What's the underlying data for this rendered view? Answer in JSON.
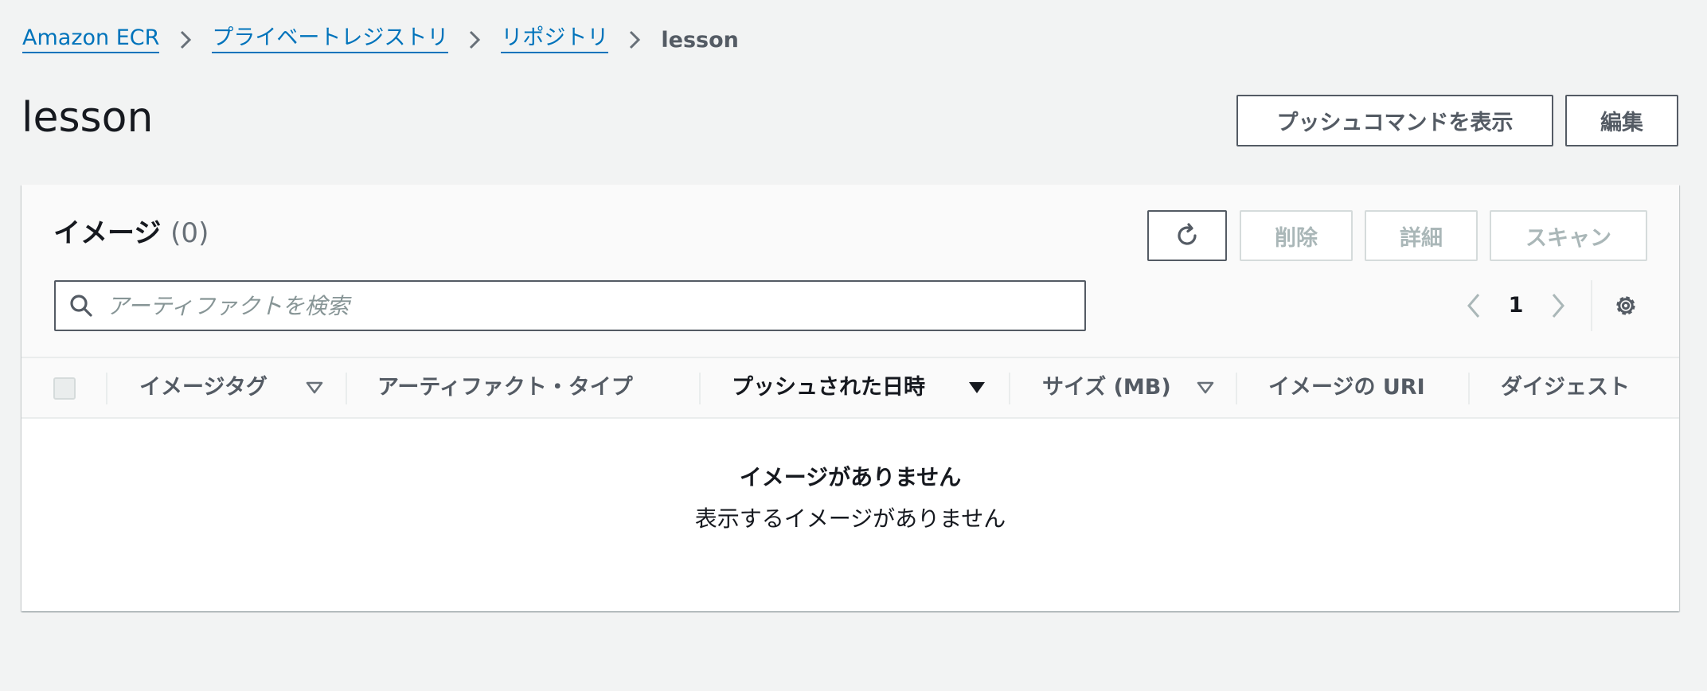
{
  "breadcrumb": {
    "items": [
      {
        "label": "Amazon ECR"
      },
      {
        "label": "プライベートレジストリ"
      },
      {
        "label": "リポジトリ"
      }
    ],
    "current": "lesson"
  },
  "page": {
    "title": "lesson",
    "push_commands_label": "プッシュコマンドを表示",
    "edit_label": "編集"
  },
  "images_panel": {
    "title": "イメージ",
    "count": "(0)",
    "delete_label": "削除",
    "details_label": "詳細",
    "scan_label": "スキャン",
    "search_placeholder": "アーティファクトを検索",
    "current_page": "1"
  },
  "table": {
    "columns": [
      {
        "label": "イメージタグ"
      },
      {
        "label": "アーティファクト・タイプ"
      },
      {
        "label": "プッシュされた日時"
      },
      {
        "label": "サイズ (MB)"
      },
      {
        "label": "イメージの URI"
      },
      {
        "label": "ダイジェスト"
      }
    ],
    "sorted_by": "プッシュされた日時",
    "rows": [],
    "empty_title": "イメージがありません",
    "empty_description": "表示するイメージがありません"
  },
  "colors": {
    "link": "#0073bb",
    "background": "#f2f3f3",
    "border_dark": "#545b64",
    "disabled_text": "#aab7b8"
  },
  "icons": [
    "chevron-right-icon",
    "refresh-icon",
    "search-icon",
    "chevron-left-icon",
    "gear-icon",
    "sort-desc-icon",
    "sort-icon"
  ]
}
